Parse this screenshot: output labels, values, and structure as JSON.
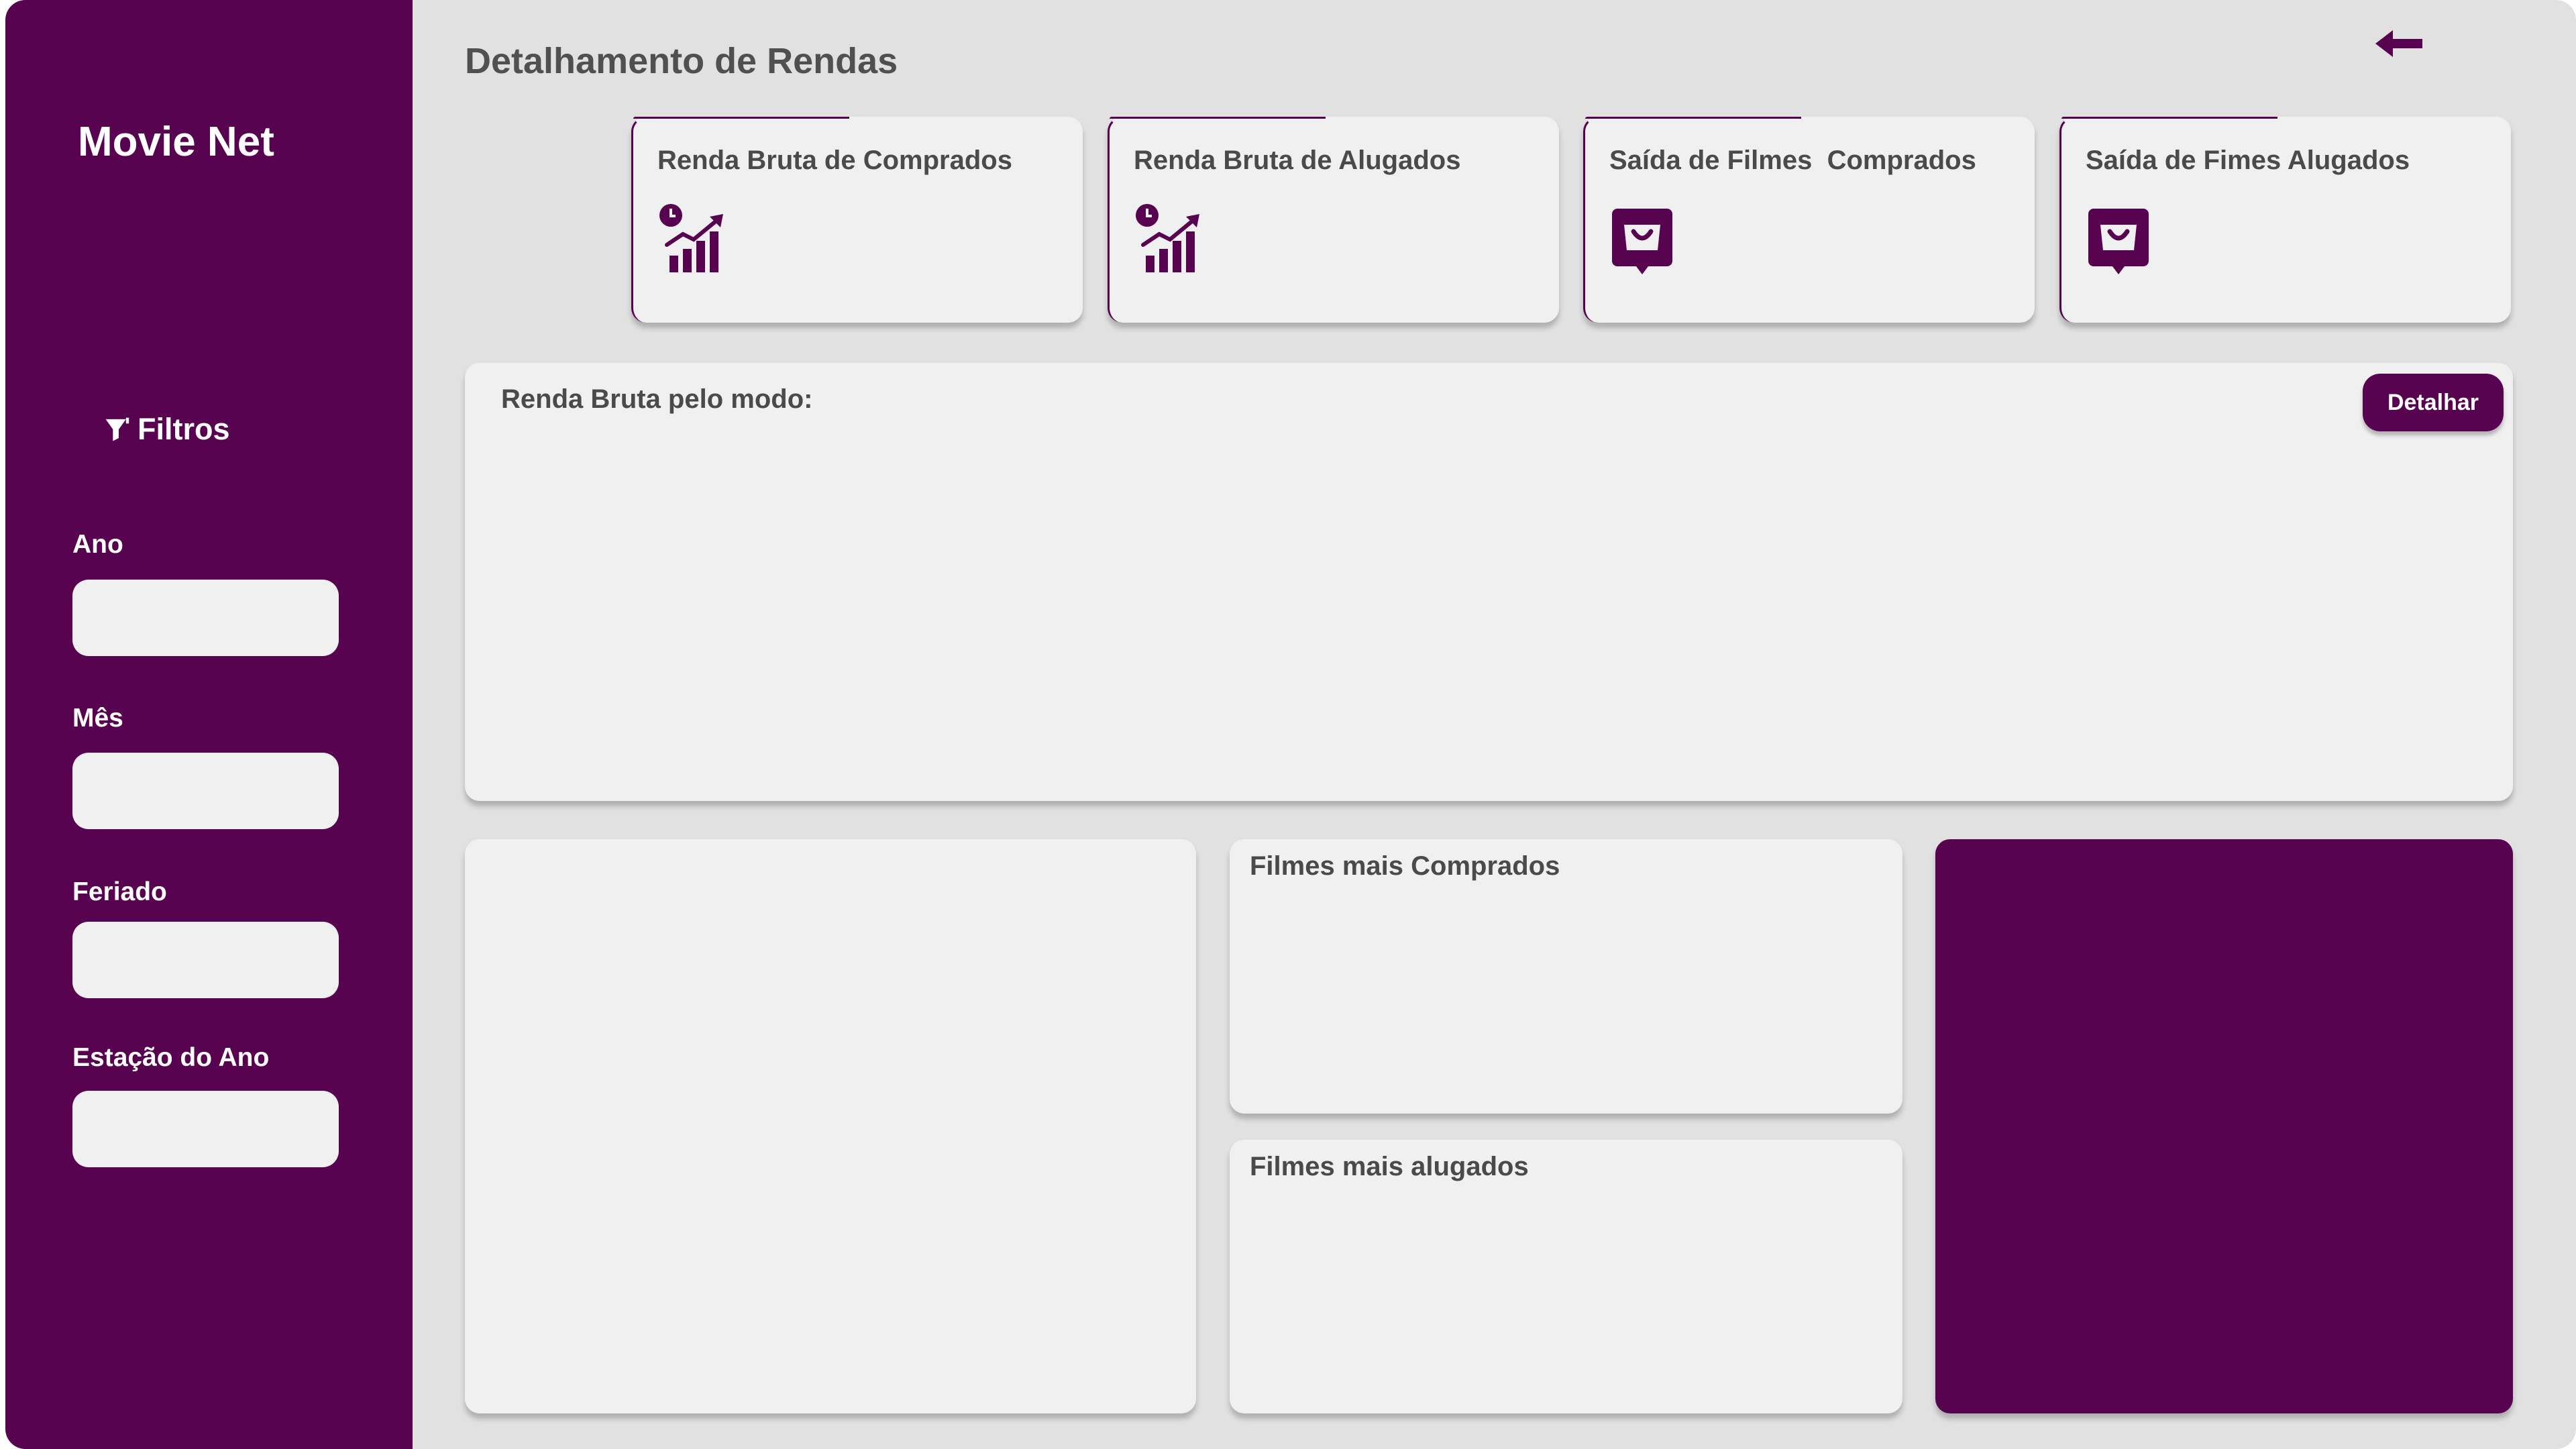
{
  "app": {
    "brand": "Movie Net"
  },
  "page": {
    "title": "Detalhamento de Rendas"
  },
  "filters": {
    "heading": "Filtros",
    "fields": [
      {
        "label": "Ano",
        "value": ""
      },
      {
        "label": "Mês",
        "value": ""
      },
      {
        "label": "Feriado",
        "value": ""
      },
      {
        "label": "Estação do Ano",
        "value": ""
      }
    ]
  },
  "cards": [
    {
      "title": "Renda Bruta de Comprados",
      "icon": "growth-chart-icon"
    },
    {
      "title": "Renda Bruta de Alugados",
      "icon": "growth-chart-icon"
    },
    {
      "title": "Saída de Filmes  Comprados",
      "icon": "shopping-bag-icon"
    },
    {
      "title": "Saída de Fimes Alugados",
      "icon": "shopping-bag-icon"
    }
  ],
  "mode_panel": {
    "title": "Renda Bruta pelo modo:",
    "button_label": "Detalhar"
  },
  "top_bought": {
    "title": "Filmes mais Comprados"
  },
  "top_rented": {
    "title": "Filmes mais alugados"
  },
  "colors": {
    "brand": "#58034f",
    "background": "#e1e1e1",
    "card": "#f0f0f0",
    "text": "#4a4a4a"
  }
}
